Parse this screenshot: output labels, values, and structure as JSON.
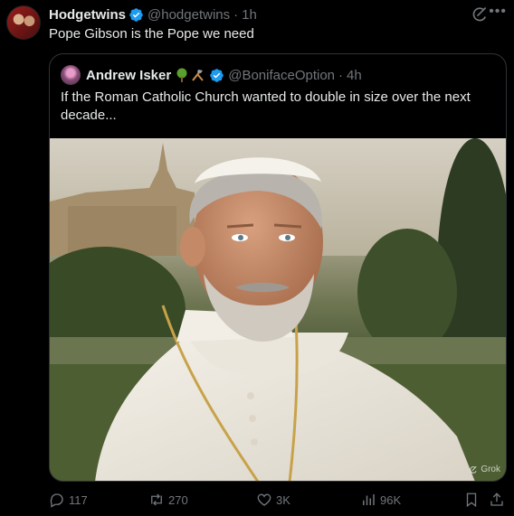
{
  "tweet": {
    "author_name": "Hodgetwins",
    "handle": "@hodgetwins",
    "separator": "·",
    "time": "1h",
    "text": "Pope Gibson is the Pope we need",
    "more_icon": "•••"
  },
  "quote": {
    "author_name": "Andrew Isker",
    "handle": "@BonifaceOption",
    "separator": "·",
    "time": "4h",
    "text": "If the Roman Catholic Church wanted to double in size over the next decade...",
    "image_watermark": "Grok"
  },
  "actions": {
    "replies": "117",
    "retweets": "270",
    "likes": "3K",
    "views": "96K"
  },
  "colors": {
    "background": "#000000",
    "text": "#e7e9ea",
    "muted": "#71767b",
    "verified": "#1d9bf0",
    "border": "#2f3336"
  }
}
